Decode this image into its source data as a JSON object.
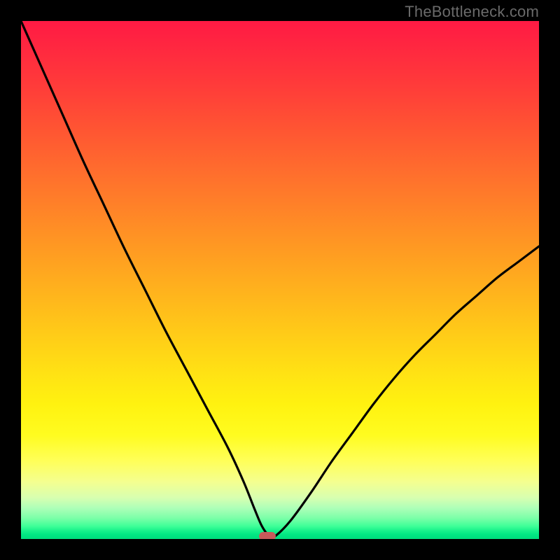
{
  "watermark": "TheBottleneck.com",
  "colors": {
    "frame": "#000000",
    "curve": "#000000",
    "marker": "#c75a5a",
    "watermark_text": "#6a6a6a"
  },
  "chart_data": {
    "type": "line",
    "title": "",
    "xlabel": "",
    "ylabel": "",
    "xlim": [
      0,
      100
    ],
    "ylim": [
      0,
      100
    ],
    "grid": false,
    "legend": false,
    "series": [
      {
        "name": "bottleneck-curve",
        "x": [
          0,
          4,
          8,
          12,
          16,
          20,
          24,
          28,
          32,
          36,
          40,
          43,
          45,
          46.5,
          48,
          49,
          52,
          56,
          60,
          64,
          68,
          72,
          76,
          80,
          84,
          88,
          92,
          96,
          100
        ],
        "values": [
          100,
          91,
          82,
          73,
          64.5,
          56,
          48,
          40,
          32.5,
          25,
          17.5,
          11,
          6,
          2.5,
          0.5,
          0.5,
          3.5,
          9,
          15,
          20.5,
          26,
          31,
          35.5,
          39.5,
          43.5,
          47,
          50.5,
          53.5,
          56.5
        ]
      }
    ],
    "annotations": [
      {
        "name": "minimum-marker",
        "x": 47.5,
        "y": 0.5
      }
    ],
    "background_gradient": {
      "direction": "top-to-bottom",
      "stops": [
        {
          "pos": 0,
          "color": "#ff1a44"
        },
        {
          "pos": 0.5,
          "color": "#ffb21d"
        },
        {
          "pos": 0.8,
          "color": "#fffc20"
        },
        {
          "pos": 0.96,
          "color": "#7affa8"
        },
        {
          "pos": 1.0,
          "color": "#00dc7d"
        }
      ]
    }
  }
}
